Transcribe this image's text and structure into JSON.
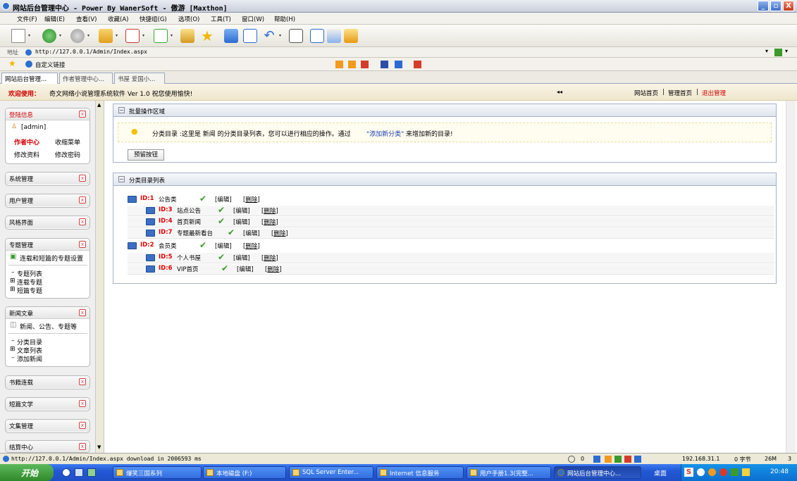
{
  "window": {
    "title": "网站后台管理中心 - Power By WanerSoft - 傲游 [Maxthon]",
    "min": "_",
    "max": "▫",
    "close": "X"
  },
  "menu": [
    "文件(F)",
    "编辑(E)",
    "查看(V)",
    "收藏(A)",
    "快捷组(G)",
    "选项(O)",
    "工具(T)",
    "窗口(W)",
    "帮助(H)"
  ],
  "address": {
    "label": "地址",
    "url": "http://127.0.0.1/Admin/Index.aspx"
  },
  "favorites": {
    "label": "自定义链接"
  },
  "tabs": [
    "网站后台管理...",
    "作者管理中心...",
    "书屋 爱国小..."
  ],
  "header": {
    "welcome": "欢迎使用：",
    "product": "奇文网络小说管理系统软件  Ver 1.0  祝您使用愉快!",
    "collapse": "◂◂",
    "links": [
      "网站首页",
      "管理首页"
    ],
    "logout": "退出管理",
    "sep": "|"
  },
  "sidebar": {
    "login": {
      "title": "登陆信息",
      "user": "[admin]",
      "links": [
        "作者中心",
        "收缩菜单",
        "修改资料",
        "修改密码"
      ]
    },
    "boxes": [
      "系统管理",
      "用户管理",
      "风格界面"
    ],
    "special": {
      "title": "专题管理",
      "subtitle": "连载和短篇的专题设置",
      "items": [
        "专题列表",
        "连载专题",
        "短篇专题"
      ]
    },
    "news": {
      "title": "新闻文章",
      "subtitle": "新闻、公告、专题等",
      "items": [
        "分类目录",
        "文章列表",
        "添加新闻"
      ]
    },
    "boxes2": [
      "书籍连载",
      "短篇文学",
      "文集管理",
      "结算中心"
    ]
  },
  "batch": {
    "title": "批量操作区域",
    "info_pre": "分类目录 :这里是 新闻 的分类目录列表，您可以进行相应的操作。通过 ",
    "info_link": "\"添加新分类\"",
    "info_post": " 来增加新的目录!",
    "button": "预留按钮"
  },
  "catlist": {
    "title": "分类目录列表",
    "edit": "[编辑]",
    "delete": "删除",
    "rows": [
      {
        "id": "ID:1",
        "name": "公告类",
        "level": 0
      },
      {
        "id": "ID:3",
        "name": "站点公告",
        "level": 1
      },
      {
        "id": "ID:4",
        "name": "首页新闻",
        "level": 1
      },
      {
        "id": "ID:7",
        "name": "专题最新看台",
        "level": 1
      },
      {
        "id": "ID:2",
        "name": "会员类",
        "level": 0
      },
      {
        "id": "ID:5",
        "name": "个人书屋",
        "level": 1
      },
      {
        "id": "ID:6",
        "name": "VIP首页",
        "level": 1
      }
    ]
  },
  "status": {
    "text": "http://127.0.0.1/Admin/Index.aspx download in 2006593 ms",
    "count": "0",
    "ip": "192.168.31.1",
    "bytes": "0 字节",
    "mem": "26M",
    "num": "3"
  },
  "taskbar": {
    "start": "开始",
    "tasks": [
      "爆笑三国系列",
      "本地磁盘 (F:)",
      "SQL Server Enter...",
      "Internet 信息服务",
      "用户手册1.3(完整...",
      "网站后台管理中心..."
    ],
    "desktop": "桌面",
    "clock": "20:48"
  },
  "colors": {
    "accent_red": "#d00000",
    "link_blue": "#1a3fb0",
    "check_green": "#3a9a2a"
  }
}
